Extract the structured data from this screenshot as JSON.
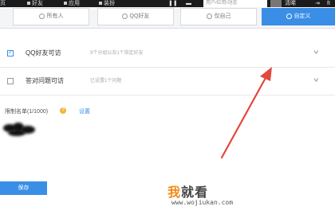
{
  "topbar": {
    "items": [
      "页",
      "好友",
      "应用",
      "装扮"
    ],
    "search_placeholder": "用户/应用/动态",
    "user": "清晞",
    "extra": "ft"
  },
  "tabs": [
    {
      "label": "所有人",
      "icon": "globe-icon"
    },
    {
      "label": "QQ好友",
      "icon": "friends-icon"
    },
    {
      "label": "仅自己",
      "icon": "lock-icon"
    },
    {
      "label": "自定义",
      "icon": "gear-icon"
    }
  ],
  "options": [
    {
      "label": "QQ好友可访",
      "sub": "9个分组以及1个指定好友",
      "checked": true
    },
    {
      "label": "答对问题可访",
      "sub": "已设置1个问题",
      "checked": false
    }
  ],
  "blacklist": {
    "label": "限制名单(1/1000)",
    "help": "?",
    "link": "设置"
  },
  "save_label": "保存",
  "watermark": {
    "first": "我",
    "rest": "就看",
    "url": "www.wojiukan.com"
  },
  "colors": {
    "accent": "#3a8ee6",
    "arrow": "#e2483d",
    "watermark_orange": "#f28a1c"
  }
}
